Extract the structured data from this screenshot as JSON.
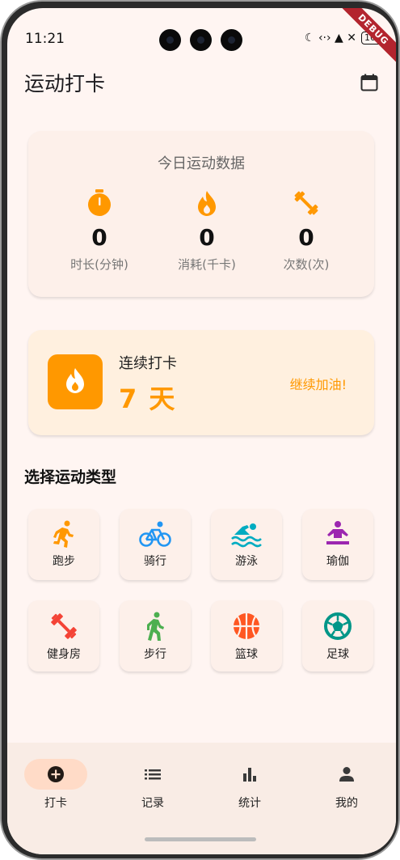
{
  "status_bar": {
    "time": "11:21",
    "icons": "☾ ‹·› ▲ ✕",
    "battery": "100",
    "debug_banner": "DEBUG"
  },
  "appbar": {
    "title": "运动打卡",
    "calendar_icon": "calendar-icon"
  },
  "today": {
    "title": "今日运动数据",
    "stats": [
      {
        "value": "0",
        "label": "时长(分钟)",
        "icon": "timer-icon"
      },
      {
        "value": "0",
        "label": "消耗(千卡)",
        "icon": "fire-icon"
      },
      {
        "value": "0",
        "label": "次数(次)",
        "icon": "dumbbell-icon"
      }
    ]
  },
  "streak": {
    "label": "连续打卡",
    "days": "7 天",
    "cheer": "继续加油!",
    "icon": "fire-icon"
  },
  "section_title": "选择运动类型",
  "sports": [
    {
      "label": "跑步",
      "icon": "running-icon",
      "color": "#ff9800"
    },
    {
      "label": "骑行",
      "icon": "bike-icon",
      "color": "#2196f3"
    },
    {
      "label": "游泳",
      "icon": "swimming-icon",
      "color": "#00acc1"
    },
    {
      "label": "瑜伽",
      "icon": "yoga-icon",
      "color": "#9c27b0"
    },
    {
      "label": "健身房",
      "icon": "dumbbell-icon",
      "color": "#f44336"
    },
    {
      "label": "步行",
      "icon": "walking-icon",
      "color": "#4caf50"
    },
    {
      "label": "篮球",
      "icon": "basketball-icon",
      "color": "#ff5722"
    },
    {
      "label": "足球",
      "icon": "soccer-icon",
      "color": "#009688"
    }
  ],
  "colors": {
    "accent": "#ff9800",
    "background": "#fff5f2",
    "card": "#fdf0ea",
    "nav_active": "#ffdbc7"
  },
  "bottom_nav": [
    {
      "label": "打卡",
      "icon": "add-circle-icon",
      "active": true
    },
    {
      "label": "记录",
      "icon": "list-icon",
      "active": false
    },
    {
      "label": "统计",
      "icon": "bar-chart-icon",
      "active": false
    },
    {
      "label": "我的",
      "icon": "person-icon",
      "active": false
    }
  ]
}
